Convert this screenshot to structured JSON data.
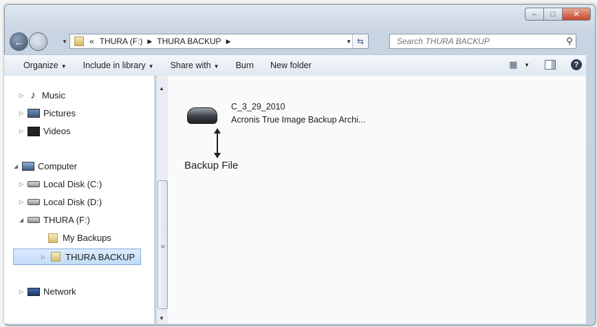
{
  "window": {
    "caption_min": "–",
    "caption_max": "□",
    "caption_close": "✕"
  },
  "address": {
    "overflow": "«",
    "crumbs": [
      "THURA (F:)",
      "THURA BACKUP"
    ]
  },
  "search": {
    "placeholder": "Search THURA BACKUP"
  },
  "toolbar": {
    "organize": "Organize",
    "include_in_library": "Include in library",
    "share_with": "Share with",
    "burn": "Burn",
    "new_folder": "New folder",
    "help": "?"
  },
  "nav": {
    "music": "Music",
    "pictures": "Pictures",
    "videos": "Videos",
    "computer": "Computer",
    "local_c": "Local Disk (C:)",
    "local_d": "Local Disk (D:)",
    "thura": "THURA (F:)",
    "my_backups": "My Backups",
    "thura_backup": "THURA BACKUP",
    "network": "Network"
  },
  "content": {
    "file_name": "C_3_29_2010",
    "file_type": "Acronis True Image Backup Archi...",
    "annotation": "Backup File"
  },
  "icons": {
    "music": "music-note-icon",
    "pictures": "pictures-icon",
    "videos": "videos-icon",
    "computer": "computer-icon",
    "disk": "disk-icon",
    "folder": "folder-icon",
    "network": "network-icon",
    "backup_archive": "backup-archive-icon"
  }
}
